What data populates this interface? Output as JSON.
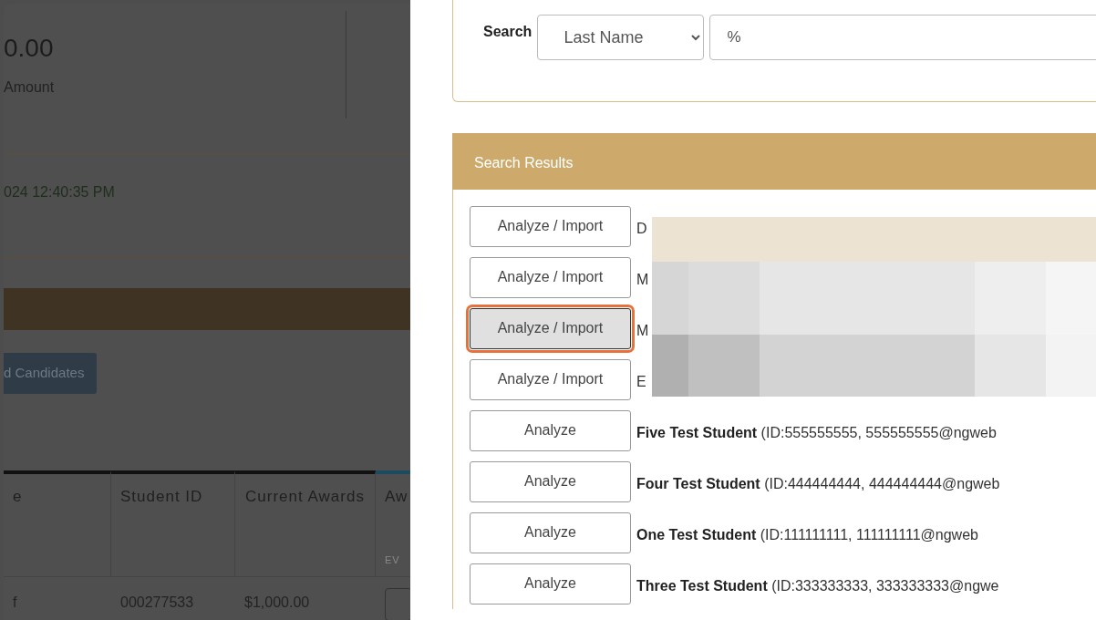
{
  "background_page": {
    "amount_value": "0.00",
    "amount_label": "Amount",
    "timestamp": "024 12:40:35 PM",
    "candidates_button": "d Candidates",
    "table": {
      "columns": [
        {
          "label": "e"
        },
        {
          "label": "Student ID"
        },
        {
          "label": "Current Awards"
        },
        {
          "label": "Aw",
          "subheading": "EV"
        }
      ],
      "rows": [
        {
          "cells": [
            "f",
            "000277533",
            "$1,000.00"
          ]
        }
      ]
    }
  },
  "search": {
    "label": "Search",
    "field_select": "Last Name",
    "query": "%"
  },
  "results": {
    "title": "Search Results",
    "rows": [
      {
        "button": "Analyze / Import",
        "selected": false,
        "student": "D"
      },
      {
        "button": "Analyze / Import",
        "selected": false,
        "student": "M"
      },
      {
        "button": "Analyze / Import",
        "selected": true,
        "student": "M"
      },
      {
        "button": "Analyze / Import",
        "selected": false,
        "student": "E"
      },
      {
        "button": "Analyze",
        "selected": false,
        "student": "**Five Test Student** (ID:555555555, 555555555@ngweb"
      },
      {
        "button": "Analyze",
        "selected": false,
        "student": "**Four Test Student** (ID:444444444, 444444444@ngweb"
      },
      {
        "button": "Analyze",
        "selected": false,
        "student": "**One Test Student** (ID:111111111, 111111111@ngweb"
      },
      {
        "button": "Analyze",
        "selected": false,
        "student": "**Three Test Student** (ID:333333333, 333333333@ngwe"
      }
    ]
  }
}
